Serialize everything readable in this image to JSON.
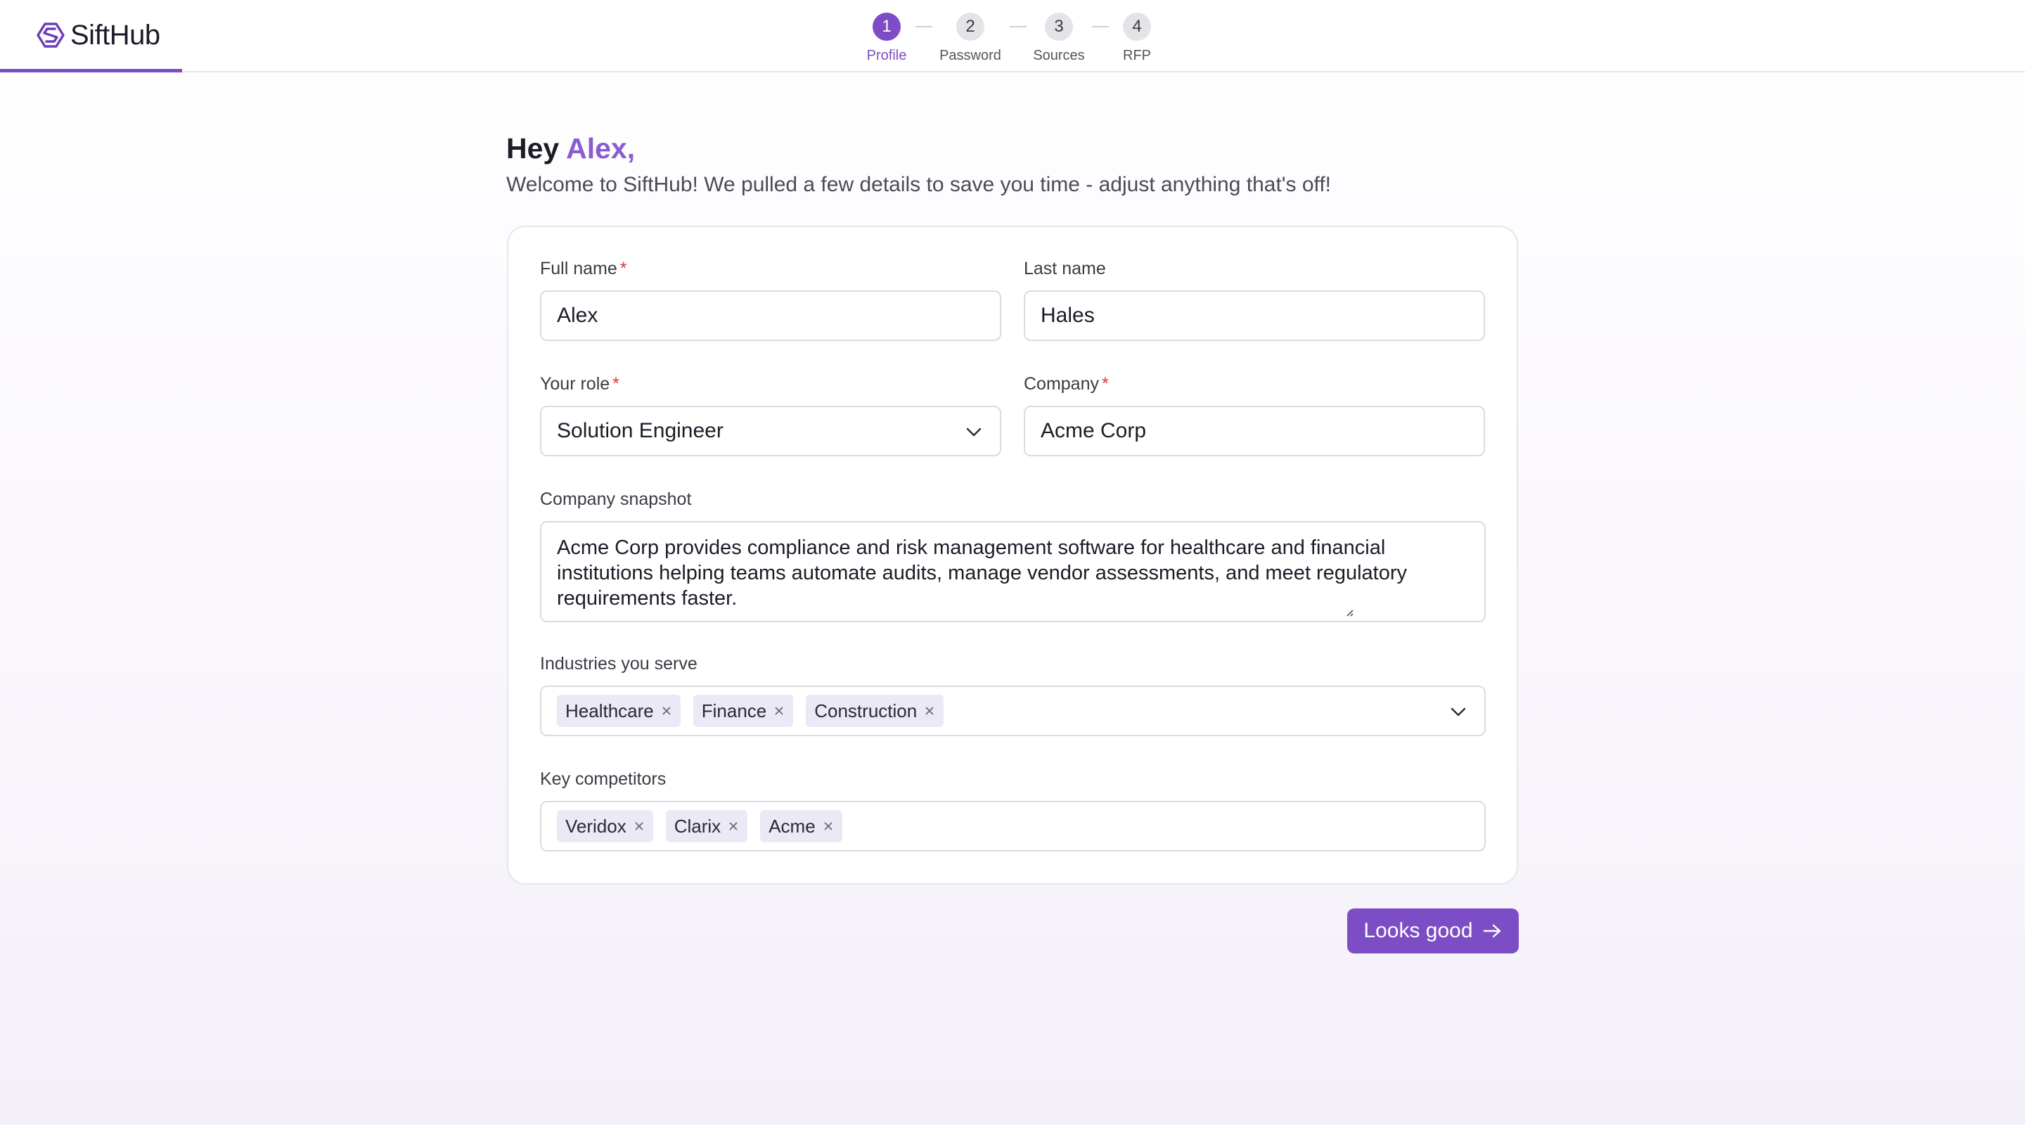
{
  "app": {
    "brand": "SiftHub",
    "accent_color": "#7c4dc4",
    "progress_fraction": 0.09
  },
  "stepper": {
    "steps": [
      {
        "number": "1",
        "label": "Profile",
        "active": true
      },
      {
        "number": "2",
        "label": "Password",
        "active": false
      },
      {
        "number": "3",
        "label": "Sources",
        "active": false
      },
      {
        "number": "4",
        "label": "RFP",
        "active": false
      }
    ]
  },
  "greeting": {
    "hey": "Hey",
    "name": "Alex,",
    "subtitle": "Welcome to SiftHub! We pulled a few details to save you time - adjust anything that's off!"
  },
  "form": {
    "full_name": {
      "label": "Full name",
      "required_mark": "*",
      "value": "Alex"
    },
    "last_name": {
      "label": "Last name",
      "value": "Hales"
    },
    "role": {
      "label": "Your role",
      "required_mark": "*",
      "value": "Solution Engineer",
      "icon": "chevron-down-icon"
    },
    "company": {
      "label": "Company",
      "required_mark": "*",
      "value": "Acme Corp"
    },
    "snapshot": {
      "label": "Company snapshot",
      "value": "Acme Corp provides compliance and risk management software for healthcare and financial institutions helping teams automate audits, manage vendor assessments, and meet regulatory requirements faster."
    },
    "industries": {
      "label": "Industries you serve",
      "tags": [
        "Healthcare",
        "Finance",
        "Construction"
      ],
      "icon": "chevron-down-icon"
    },
    "competitors": {
      "label": "Key competitors",
      "tags": [
        "Veridox",
        "Clarix",
        "Acme"
      ]
    }
  },
  "actions": {
    "submit_label": "Looks good",
    "submit_icon": "arrow-right-icon"
  }
}
